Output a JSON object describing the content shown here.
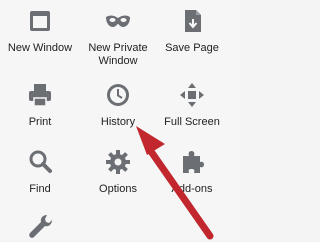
{
  "menu": {
    "items": [
      {
        "label": "New Window",
        "icon": "window-icon"
      },
      {
        "label": "New Private Window",
        "icon": "mask-icon"
      },
      {
        "label": "Save Page",
        "icon": "save-page-icon"
      },
      {
        "label": "Print",
        "icon": "printer-icon"
      },
      {
        "label": "History",
        "icon": "clock-icon"
      },
      {
        "label": "Full Screen",
        "icon": "fullscreen-icon"
      },
      {
        "label": "Find",
        "icon": "magnifier-icon"
      },
      {
        "label": "Options",
        "icon": "gear-icon"
      },
      {
        "label": "Add-ons",
        "icon": "puzzle-icon"
      },
      {
        "label": "",
        "icon": "wrench-icon"
      }
    ]
  },
  "colors": {
    "icon": "#6b6f74",
    "arrow": "#c1272d",
    "background": "#f6f6f6",
    "text": "#222222"
  }
}
